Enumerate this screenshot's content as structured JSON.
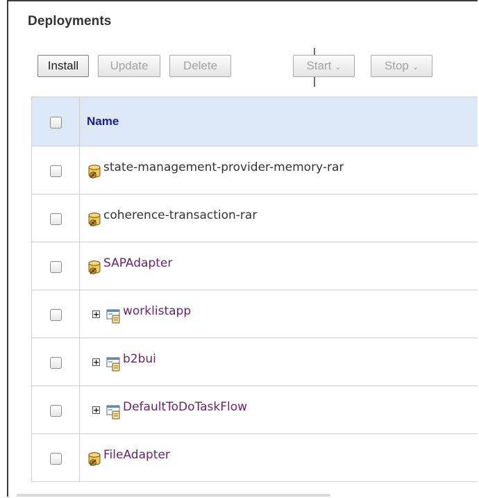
{
  "panel": {
    "title": "Deployments"
  },
  "toolbar": {
    "install_label": "Install",
    "update_label": "Update",
    "delete_label": "Delete",
    "start_label": "Start",
    "stop_label": "Stop"
  },
  "table": {
    "header_name": "Name",
    "rows": [
      {
        "name": "state-management-provider-memory-rar",
        "type": "rar",
        "icon": "resource-adapter-icon",
        "expandable": false
      },
      {
        "name": "coherence-transaction-rar",
        "type": "rar",
        "icon": "resource-adapter-icon",
        "expandable": false
      },
      {
        "name": "SAPAdapter",
        "type": "link",
        "icon": "resource-adapter-icon",
        "expandable": false
      },
      {
        "name": "worklistapp",
        "type": "link",
        "icon": "enterprise-app-icon",
        "expandable": true
      },
      {
        "name": "b2bui",
        "type": "link",
        "icon": "enterprise-app-icon",
        "expandable": true
      },
      {
        "name": "DefaultToDoTaskFlow",
        "type": "link",
        "icon": "enterprise-app-icon",
        "expandable": true
      },
      {
        "name": "FileAdapter",
        "type": "link",
        "icon": "resource-adapter-icon",
        "expandable": false
      }
    ]
  },
  "colors": {
    "header_bg": "#dce8f5",
    "header_text": "#1a1e8c",
    "link_text": "#6a1f6a"
  }
}
